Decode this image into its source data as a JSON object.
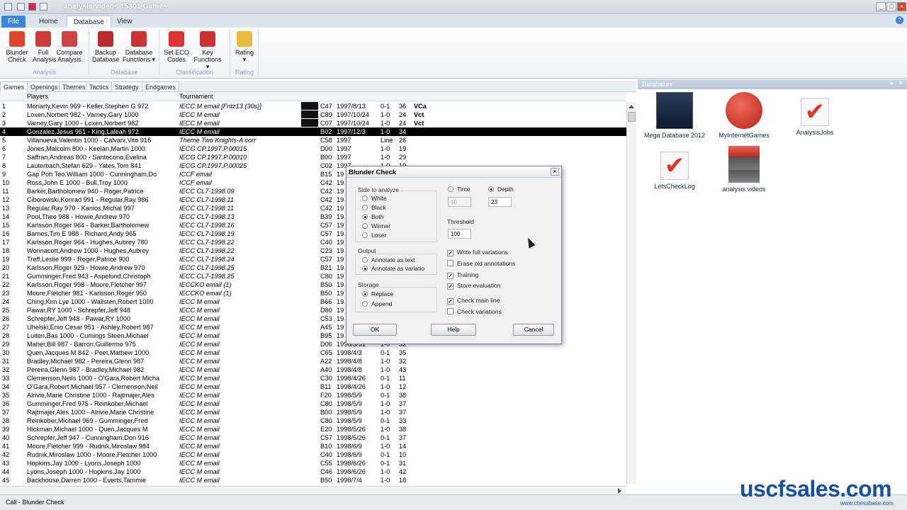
{
  "window": {
    "title": "analysis videos  15301 Games"
  },
  "ribbon_tabs": [
    "File",
    "Home",
    "Database",
    "View"
  ],
  "ribbon": {
    "buttons": [
      {
        "l1": "Blunder",
        "l2": "Check",
        "icon": "bug-icon",
        "color": "#e0462f"
      },
      {
        "l1": "Full",
        "l2": "Analysis",
        "icon": "analysis-icon",
        "color": "#cc3a3a"
      },
      {
        "l1": "Compare",
        "l2": "Analysis",
        "icon": "compare-icon",
        "color": "#c44"
      },
      {
        "l1": "Backup",
        "l2": "Database",
        "icon": "backup-icon",
        "color": "#b72c2c"
      },
      {
        "l1": "Database",
        "l2": "Functions ▾",
        "icon": "db-functions-icon",
        "color": "#c33"
      },
      {
        "l1": "Set ECO",
        "l2": "Codes",
        "icon": "eco-icon",
        "color": "#d33"
      },
      {
        "l1": "Key",
        "l2": "Functions ▾",
        "icon": "key-icon",
        "color": "#c33"
      },
      {
        "l1": "Rating",
        "l2": "▾",
        "icon": "rating-icon",
        "color": "#e8b93a"
      }
    ],
    "groups": [
      "Analysis",
      "Database",
      "Classification",
      "Rating"
    ]
  },
  "game_tabs": [
    "Games",
    "Openings",
    "Themes",
    "Tactics",
    "Strategy",
    "Endgames"
  ],
  "list_headers": {
    "players": "Players",
    "tournament": "Tournament"
  },
  "games": [
    [
      "1",
      "Moriarty,Kevin 969 - Keller,Stephen G 972",
      "IECC M email [Fritz13 (30s)]",
      "C47",
      "1997/8/13",
      "0-1",
      "36",
      "VCa"
    ],
    [
      "2",
      "Loxen,Norbert 982 - Varney,Gary 1000",
      "IECC M email",
      "C89",
      "1997/10/24",
      "1-0",
      "24",
      "Vct"
    ],
    [
      "3",
      "Varney,Gary 1000 - Loxen,Norbert 982",
      "IECC M email",
      "C07",
      "1997/10/24",
      "1-0",
      "24",
      "Vct"
    ],
    [
      "4",
      "Gonzalez,Jesus 961 - King,Laleah 972",
      "IECC M email",
      "B02",
      "1997/12/3",
      "1-0",
      "34",
      ""
    ],
    [
      "5",
      "Villanueva,Valentin 1000 - Calvani,Vito 916",
      "Theme Two Knights-A corr",
      "C58",
      "1997",
      "Line",
      "26",
      ""
    ],
    [
      "6",
      "Jones,Malcolm 800 - Keelan,Martin 1000",
      "IECG CP.1997.P.00015",
      "D00",
      "1997",
      "1-0",
      "19",
      ""
    ],
    [
      "7",
      "Saffran,Andreas 800 - Santocono,Evelina",
      "IECG CP.1997.P.00010",
      "B00",
      "1997",
      "1-0",
      "29",
      ""
    ],
    [
      "8",
      "Lauterbach,Stefan 629 - Yates,Tom 841",
      "IECG CP.1997.P.00025",
      "C02",
      "1997",
      "1-0",
      "19",
      ""
    ],
    [
      "9",
      "Gap Poh Teo,William 1000 - Cunningham,Do",
      "ICCF email",
      "B15",
      "19",
      "",
      "",
      " "
    ],
    [
      "10",
      "Ross,John E 1000 - Bull,Troy 1000",
      "ICCF email",
      "C42",
      "19",
      "",
      "",
      ""
    ],
    [
      "11",
      "Barker,Bartholomew 940 - Roger,Patrice",
      "IECC CL7-1998.09",
      "C42",
      "19",
      "",
      "",
      ""
    ],
    [
      "12",
      "Ciborowski,Konrad 991 - Regular,Ray 986",
      "IECC CL7-1998.11",
      "C42",
      "19",
      "",
      "",
      ""
    ],
    [
      "13",
      "Regular,Ray 970 - Kanios,Michal 997",
      "IECC CL7-1998.11",
      "C42",
      "19",
      "",
      "",
      ""
    ],
    [
      "14",
      "Pool,Theo 988 - Howie,Andrew 970",
      "IECC CL7-1998.13",
      "B39",
      "19",
      "",
      "",
      ""
    ],
    [
      "15",
      "Karlsson,Roger 964 - Barker,Bartholomew",
      "IECC CL7-1998.16",
      "C57",
      "19",
      "",
      "",
      ""
    ],
    [
      "16",
      "Barnes,Tim E 988 - Richard,Andy 965",
      "IECC CL7-1998.19",
      "C57",
      "19",
      "",
      "",
      ""
    ],
    [
      "17",
      "Karlsson,Roger 964 - Hughes,Aubrey 780",
      "IECC CL7-1998.22",
      "C40",
      "19",
      "",
      "",
      ""
    ],
    [
      "18",
      "Wonnacott,Andrew 1000 - Hughes,Aubrey",
      "IECC CL7-1998.22",
      "C23",
      "19",
      "",
      "",
      ""
    ],
    [
      "19",
      "Treff,Leslie 999 - Roger,Patrice 900",
      "IECC CL7-1998.24",
      "C57",
      "19",
      "",
      "",
      ""
    ],
    [
      "20",
      "Karlsson,Roger 929 - Howie,Andrew 970",
      "IECC CL7-1998.25",
      "B21",
      "19",
      "",
      "",
      ""
    ],
    [
      "21",
      "Gumminger,Fred 943 - Aspelund,Christoph",
      "IECC CL7-1998.25",
      "C80",
      "19",
      "",
      "",
      ""
    ],
    [
      "22",
      "Karlsson,Roger 998 - Moore,Fletcher 997",
      "IECCKO email (1)",
      "B50",
      "19",
      "",
      "",
      ""
    ],
    [
      "23",
      "Moore,Fletcher 981 - Karlsson,Roger 950",
      "IECCKO email (1)",
      "B50",
      "19",
      "",
      "",
      ""
    ],
    [
      "24",
      "Ching,Kim Lye 1000 - Wallsten,Robert 1000",
      "IECC M email",
      "B66",
      "19",
      "",
      "",
      ""
    ],
    [
      "25",
      "Pawar,RY 1000 - Schrepfer,Jeff 948",
      "IECC M email",
      "D80",
      "19",
      "",
      "",
      ""
    ],
    [
      "26",
      "Schrepfer,Jeff 948 - Pawar,RY 1000",
      "IECC M email",
      "C53",
      "19",
      "",
      "",
      ""
    ],
    [
      "27",
      "Uhelski,Enio Cesar 951 - Ashley,Robert 987",
      "IECC M email",
      "A45",
      "19",
      "",
      "",
      ""
    ],
    [
      "28",
      "Luiten,Bas 1000 - Cumings Steen,Michael",
      "IECC M email",
      "B95",
      "19",
      "",
      "",
      ""
    ],
    [
      "29",
      "Maher,Bill 987 - Barron,Guillermo 975",
      "IECC M email",
      "D06",
      "1998/3/31",
      "1-0",
      "32",
      ""
    ],
    [
      "30",
      "Quen,Jacques M 842 - Peet,Mathew 1000",
      "IECC M email",
      "C65",
      "1998/4/3",
      "0-1",
      "35",
      ""
    ],
    [
      "31",
      "Bradley,Michael 982 - Pereira,Glenn 987",
      "IECC M email",
      "A22",
      "1998/4/8",
      "1-0",
      "32",
      ""
    ],
    [
      "32",
      "Pereira,Glenn 987 - Bradley,Michael 982",
      "IECC M email",
      "A40",
      "1998/4/8",
      "1-0",
      "43",
      ""
    ],
    [
      "33",
      "Clemenson,Neils 1000 - O'Gara,Robert Micha",
      "IECC M email",
      "C30",
      "1998/4/26",
      "0-1",
      "11",
      ""
    ],
    [
      "34",
      "O'Gara,Robert Michael 957 - Clemenson,Neil",
      "IECC M email",
      "B11",
      "1998/4/26",
      "1-0",
      "12",
      ""
    ],
    [
      "35",
      "Alrivie,Marie Christine 1000 - Rajtmajer,Ales",
      "IECC M email",
      "F20",
      "1998/5/9",
      "0-1",
      "38",
      ""
    ],
    [
      "36",
      "Gumminger,Fred 975 - Reinkober,Michael",
      "IECC M email",
      "C80",
      "1998/5/9",
      "1-0",
      "37",
      ""
    ],
    [
      "37",
      "Rajtmajer,Ales 1000 - Alrivie,Marie Christine",
      "IECC M email",
      "B00",
      "1998/5/9",
      "1-0",
      "37",
      ""
    ],
    [
      "38",
      "Reinkober,Michael 969 - Gumminger,Fred",
      "IECC M email",
      "C80",
      "1998/5/9",
      "0-1",
      "33",
      ""
    ],
    [
      "39",
      "Hickman,Michael 1000 - Quen,Jacques M",
      "IECC M email",
      "E20",
      "1998/5/26",
      "1-0",
      "38",
      ""
    ],
    [
      "40",
      "Schrepfer,Jeff 947 - Cunningham,Don 916",
      "IECC M email",
      "C57",
      "1998/5/26",
      "0-1",
      "37",
      ""
    ],
    [
      "41",
      "Moore,Fletcher 999 - Rudnik,Miroslaw 984",
      "IECC M email",
      "B10",
      "1998/6/9",
      "1-0",
      "14",
      ""
    ],
    [
      "42",
      "Rudnik,Miroslaw 1000 - Moore,Fletcher 1000",
      "IECC M email",
      "C40",
      "1998/6/9",
      "0-1",
      "10",
      ""
    ],
    [
      "43",
      "Hopkins,Jay 1000 - Lyons,Joseph 1000",
      "IECC M email",
      "C55",
      "1998/6/26",
      "0-1",
      "31",
      ""
    ],
    [
      "44",
      "Lyons,Joseph 1000 - Hopkins,Jay 1000",
      "IECC M email",
      "C46",
      "1998/6/26",
      "1-0",
      "42",
      ""
    ],
    [
      "45",
      "Backhouse,Darren 1000 - Everts,Tammie",
      "IECC M email",
      "B50",
      "1998/7/4",
      "1-0",
      "18",
      ""
    ]
  ],
  "selected_row": "4",
  "databases": {
    "panel_title": "Databases",
    "items": [
      {
        "label": "Mega Database 2012",
        "icon": "mega-database-icon"
      },
      {
        "label": "MyInternetGames",
        "icon": "internet-games-icon"
      },
      {
        "label": "AnalysisJobs",
        "icon": "analysis-jobs-icon"
      },
      {
        "label": "LetsCheckLog",
        "icon": "letscheck-log-icon"
      },
      {
        "label": "analysis videos",
        "icon": "analysis-videos-db-icon"
      }
    ]
  },
  "dialog": {
    "title": "Blunder Check",
    "side_label": "Side to analyze",
    "side_options": [
      "White",
      "Black",
      "Both",
      "Winner",
      "Loser"
    ],
    "side_selected": "Both",
    "output_label": "Output",
    "output_options": [
      "Annotate as text",
      "Annotate as variatio"
    ],
    "output_selected": "Annotate as variatio",
    "storage_label": "Storage",
    "storage_options": [
      "Replace",
      "Append"
    ],
    "storage_selected": "Replace",
    "time_label": "Time",
    "depth_label": "Depth",
    "time_value": "10",
    "depth_value": "23",
    "threshold_label": "Threshold",
    "threshold_value": "100",
    "checks": [
      {
        "label": "Write full variations",
        "checked": true
      },
      {
        "label": "Erase old annotations",
        "checked": false
      },
      {
        "label": "Training",
        "checked": true
      },
      {
        "label": "Store evaluation",
        "checked": true
      },
      {
        "label": "Check main line",
        "checked": true
      },
      {
        "label": "Check variations",
        "checked": false
      }
    ],
    "ok": "OK",
    "help": "Help",
    "cancel": "Cancel"
  },
  "status": "Call - Blunder Check",
  "brand": "uscfsales.com",
  "brand_sub": "www.chessbase.com"
}
